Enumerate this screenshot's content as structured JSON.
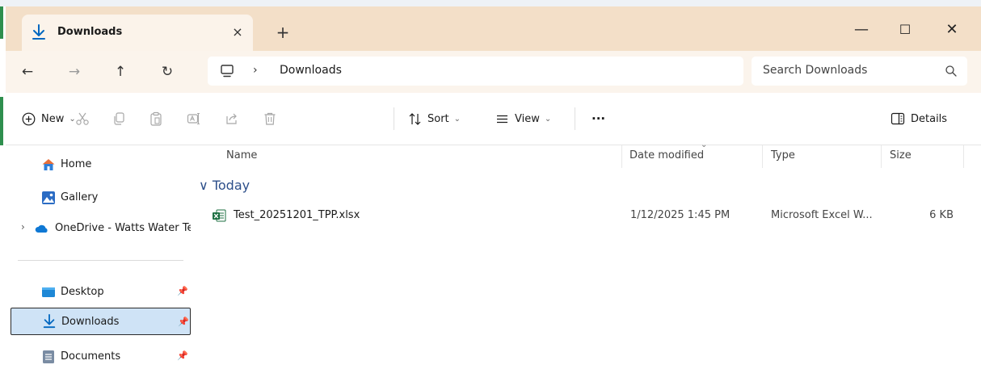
{
  "window": {
    "tab_title": "Downloads",
    "tab_close": "×",
    "new_tab": "+",
    "minimize": "—",
    "maximize": "☐",
    "close": "✕"
  },
  "addressbar": {
    "back": "←",
    "forward": "→",
    "up": "↑",
    "refresh": "↻",
    "separator": "›",
    "crumb": "Downloads",
    "search_placeholder": "Search Downloads"
  },
  "toolbar": {
    "new_label": "New",
    "sort_label": "Sort",
    "view_label": "View",
    "more_label": "···",
    "details_label": "Details",
    "chevron": "⌄"
  },
  "sidebar": {
    "items": [
      {
        "label": "Home",
        "icon": "home-icon"
      },
      {
        "label": "Gallery",
        "icon": "gallery-icon"
      },
      {
        "label": "OneDrive - Watts Water Technologies",
        "icon": "onedrive-icon"
      },
      {
        "label": "Desktop",
        "icon": "desktop-icon"
      },
      {
        "label": "Downloads",
        "icon": "downloads-icon"
      },
      {
        "label": "Documents",
        "icon": "documents-icon"
      }
    ],
    "expander": "›",
    "pin": "📌"
  },
  "filelist": {
    "columns": {
      "name": "Name",
      "date": "Date modified",
      "type": "Type",
      "size": "Size"
    },
    "group": "Today",
    "group_chevron": "∨",
    "rows": [
      {
        "name": "Test_20251201_TPP.xlsx",
        "date": "1/12/2025 1:45 PM",
        "type": "Microsoft Excel W...",
        "size": "6 KB"
      }
    ]
  },
  "colors": {
    "titlebar": "#f3dfc8",
    "addressbar": "#fbf4ec",
    "accent": "#0067c0",
    "selection": "#cfe3f6",
    "excel_green": "#1d6f42"
  }
}
